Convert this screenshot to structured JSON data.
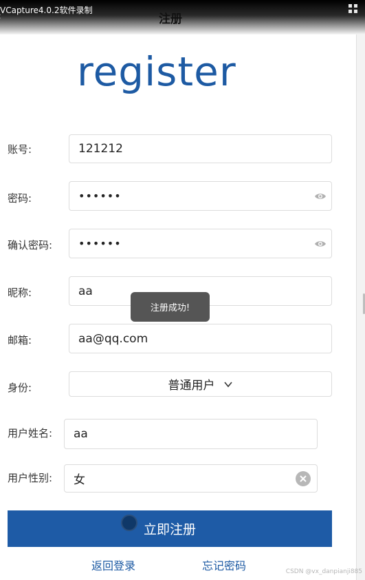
{
  "watermark": {
    "text": "VCapture4.0.2软件录制"
  },
  "header": {
    "title": "注册"
  },
  "logo": {
    "text": "register"
  },
  "form": {
    "account": {
      "label": "账号:",
      "value": "121212"
    },
    "password": {
      "label": "密码:",
      "value": "••••••"
    },
    "confirm_password": {
      "label": "确认密码:",
      "value": "••••••"
    },
    "nickname": {
      "label": "昵称:",
      "value": "aa"
    },
    "email": {
      "label": "邮箱:",
      "value": "aa@qq.com"
    },
    "role": {
      "label": "身份:",
      "value": "普通用户"
    },
    "real_name": {
      "label": "用户姓名:",
      "value": "aa"
    },
    "gender": {
      "label": "用户性别:",
      "value": "女"
    }
  },
  "toast": {
    "text": "注册成功!"
  },
  "actions": {
    "submit_label": "立即注册",
    "back_login_label": "返回登录",
    "forgot_password_label": "忘记密码"
  },
  "footer": {
    "credit": "CSDN @vx_danpianji885"
  },
  "colors": {
    "primary": "#1e5ba6",
    "toast_bg": "#555555"
  },
  "icons": [
    "chevron-left-icon",
    "menu-grid-icon",
    "eye-icon",
    "chevron-down-icon",
    "clear-icon"
  ]
}
